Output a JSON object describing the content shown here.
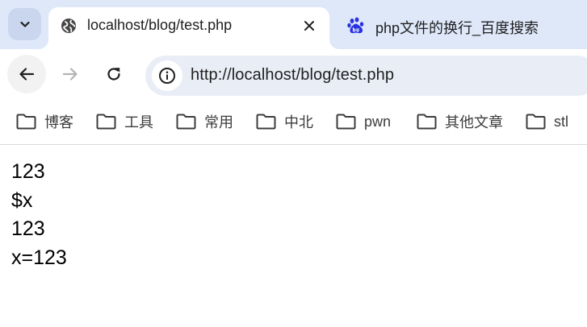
{
  "tabs": {
    "active": {
      "title": "localhost/blog/test.php",
      "favicon": "globe-icon"
    },
    "inactive": {
      "title": "php文件的换行_百度搜索",
      "favicon": "baidu-paw-icon"
    }
  },
  "toolbar": {
    "url": "http://localhost/blog/test.php"
  },
  "bookmarks": [
    {
      "label": "博客"
    },
    {
      "label": "工具"
    },
    {
      "label": "常用"
    },
    {
      "label": "中北"
    },
    {
      "label": "pwn"
    },
    {
      "label": "其他文章"
    },
    {
      "label": "stl"
    }
  ],
  "page": {
    "lines": [
      "123",
      "$x",
      "123",
      "x=123"
    ]
  },
  "colors": {
    "tabstrip_bg": "#dee8f9",
    "omnibox_bg": "#e9eef6",
    "baidu_blue": "#2932e1"
  }
}
